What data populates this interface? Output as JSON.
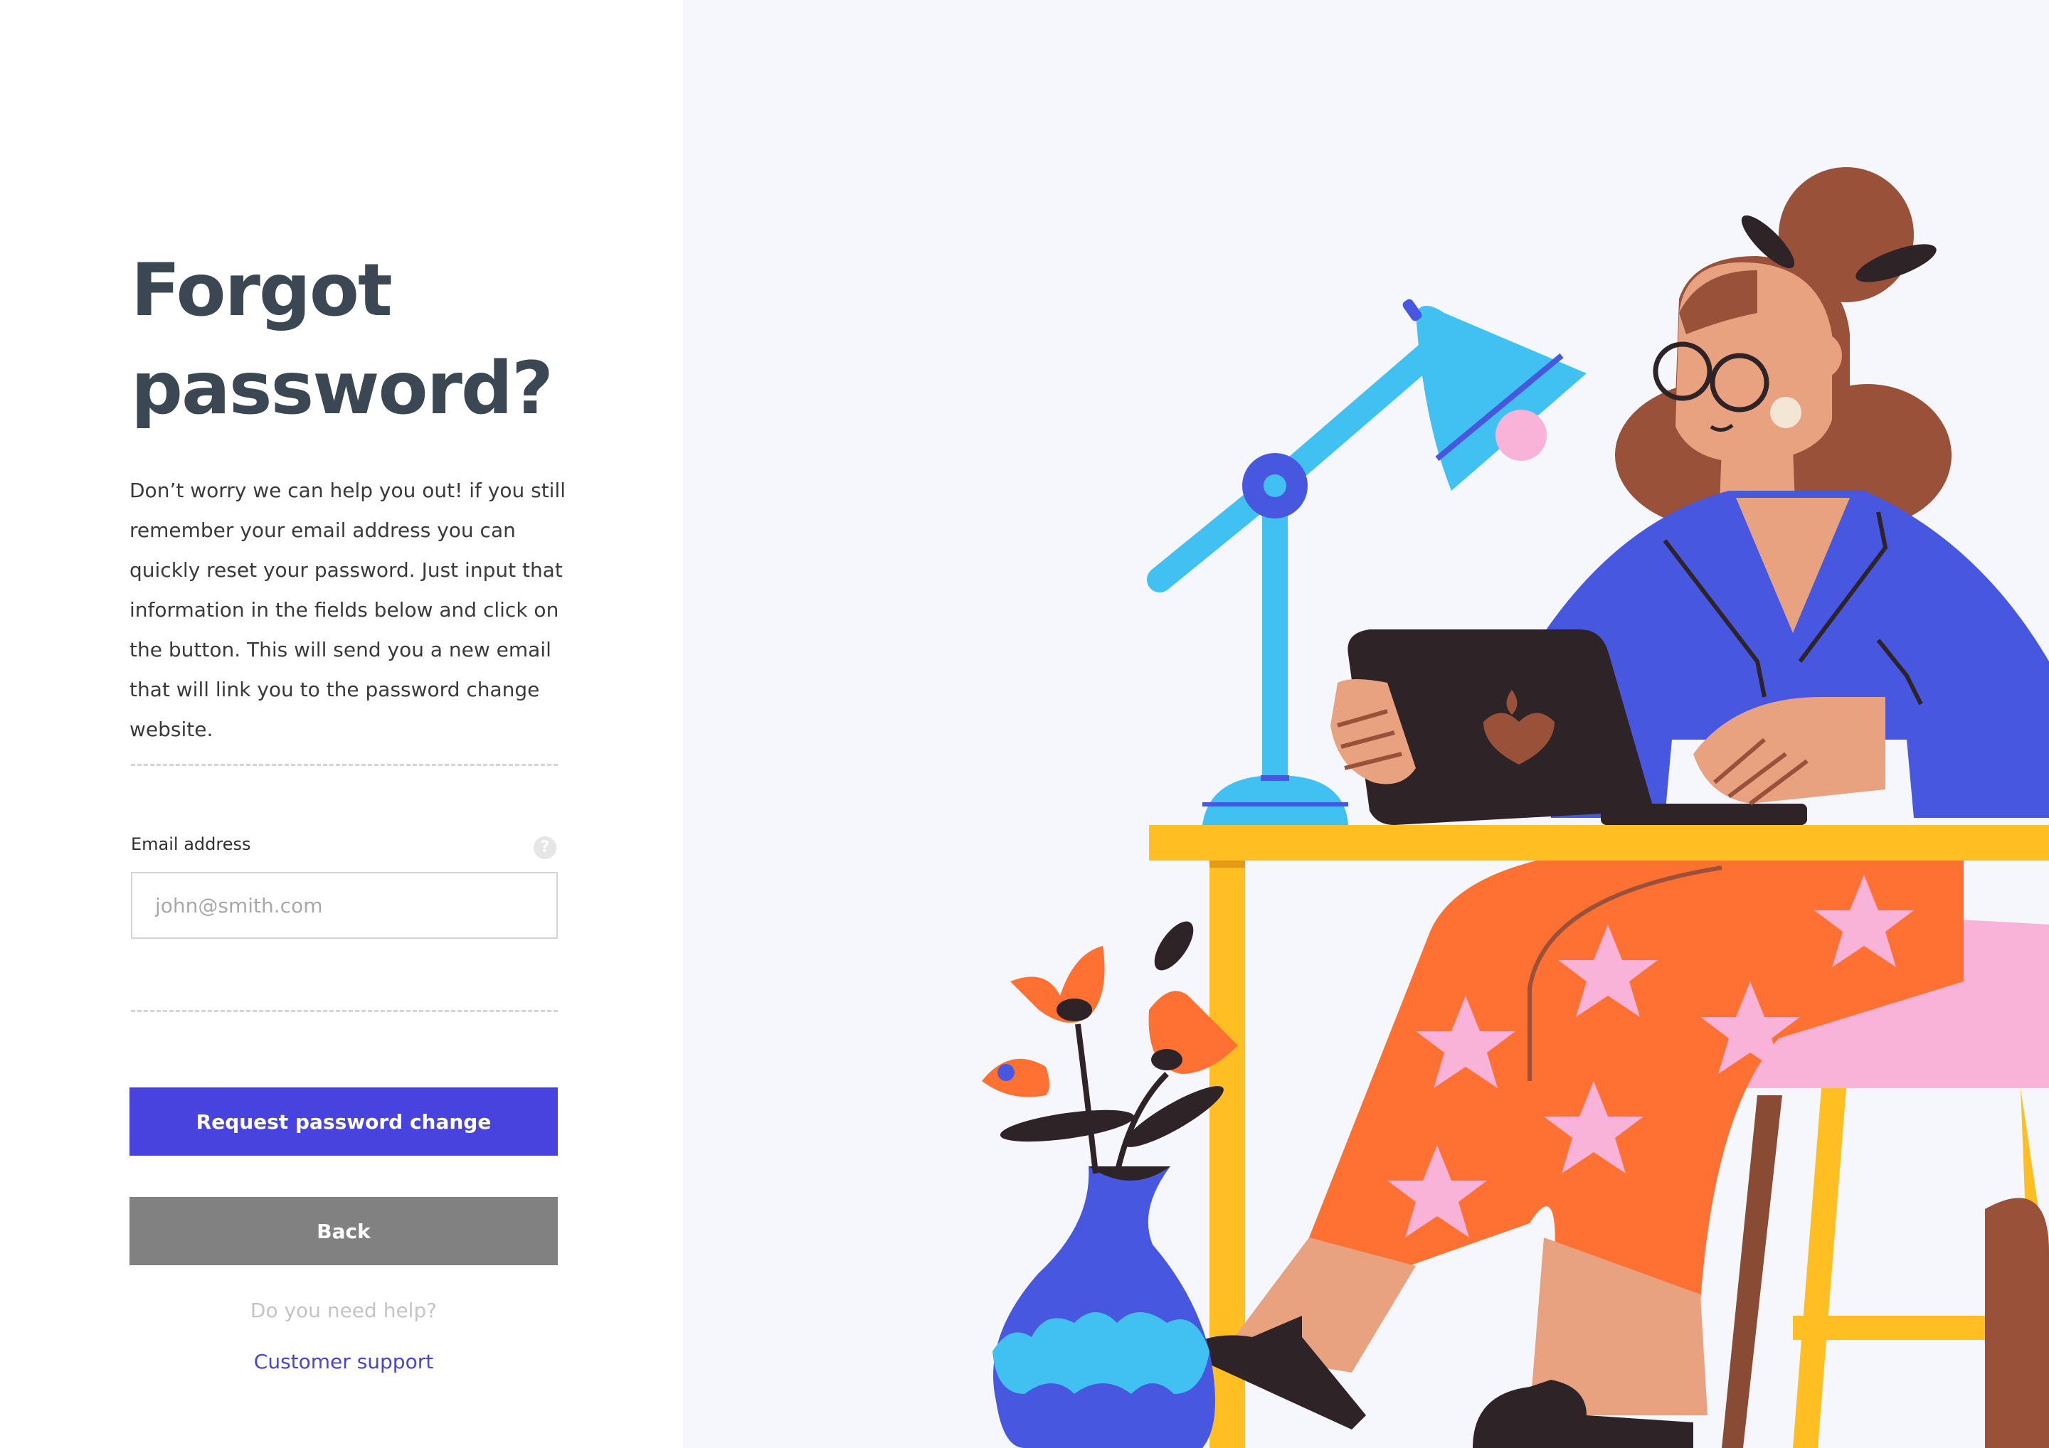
{
  "form": {
    "title": "Forgot password?",
    "description": "Don’t worry we can help you out! if you still remember your email address you can quickly reset your password. Just input that information in the fields below and click on the button. This will send you a new email that will link you to the password change website.",
    "email_label": "Email address",
    "help_icon_glyph": "?",
    "email_placeholder": "john@smith.com",
    "email_value": "",
    "request_button": "Request password change",
    "back_button": "Back",
    "help_text": "Do you need help?",
    "support_link": "Customer support"
  },
  "colors": {
    "primary": "#4842df",
    "back_button": "#818181",
    "title": "#3b4753",
    "background": "#f6f7fc"
  },
  "icons": [
    "help-icon",
    "illustration-woman-at-desk"
  ]
}
